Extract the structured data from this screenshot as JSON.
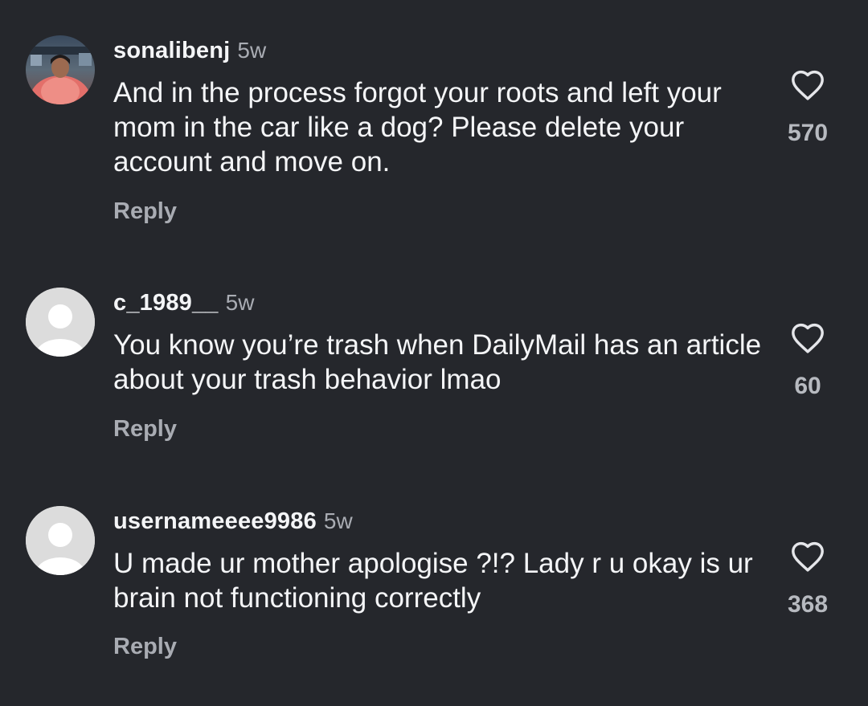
{
  "comments": [
    {
      "username": "sonalibenj",
      "time": "5w",
      "text": "And in the process forgot your roots and left your mom in the car like a dog? Please delete your account and move on.",
      "reply_label": "Reply",
      "likes": "570",
      "avatar": "photo-avatar"
    },
    {
      "username": "c_1989__",
      "time": "5w",
      "text": "You know you’re trash when DailyMail has an article about your trash behavior lmao",
      "reply_label": "Reply",
      "likes": "60",
      "avatar": "default-avatar"
    },
    {
      "username": "usernameeee9986",
      "time": "5w",
      "text": "U made ur mother apologise ?!? Lady r u okay is ur brain not functioning correctly",
      "reply_label": "Reply",
      "likes": "368",
      "avatar": "default-avatar"
    }
  ],
  "icons": {
    "like": "heart-outline-icon",
    "avatar_placeholder": "person-silhouette-icon"
  },
  "colors": {
    "background": "#25272c",
    "primary_text": "#f4f5f7",
    "secondary_text": "#a9acb3",
    "default_avatar": "#dcdcdc"
  }
}
